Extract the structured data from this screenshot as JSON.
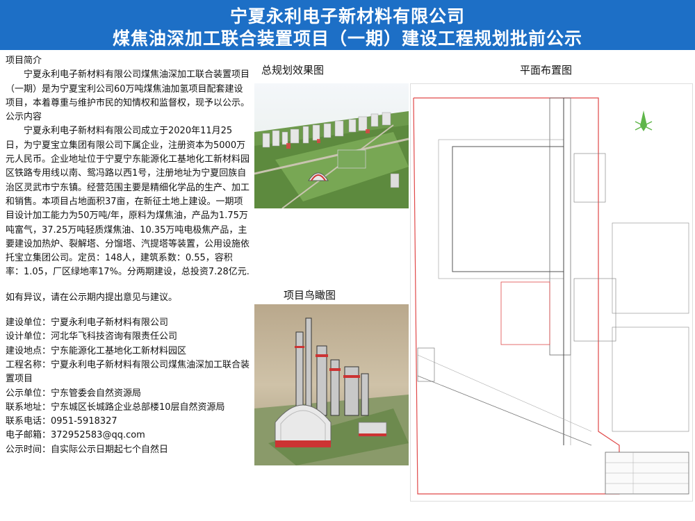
{
  "header": {
    "title_line1": "宁夏永利电子新材料有限公司",
    "title_line2": "煤焦油深加工联合装置项目（一期）建设工程规划批前公示"
  },
  "intro": {
    "heading": "项目简介",
    "text": "宁夏永利电子新材料有限公司煤焦油深加工联合装置项目（一期）是为宁夏宝利公司60万吨煤焦油加氢项目配套建设项目，本着尊重与维护市民的知情权和监督权，现予以公示。"
  },
  "content": {
    "heading": "公示内容",
    "text": "宁夏永利电子新材料有限公司成立于2020年11月25日，为宁夏宝立集团有限公司下属企业，注册资本为5000万元人民币。企业地址位于宁夏宁东能源化工基地化工新材料园区铁路专用线以南、鸳冯路以西1号，注册地址为宁夏回族自治区灵武市宁东镇。经营范围主要是精细化学品的生产、加工和销售。本项目占地面积37亩，在新征土地上建设。一期项目设计加工能力为50万吨/年，原料为煤焦油，产品为1.75万吨富气，37.25万吨轻质煤焦油、10.35万吨电极焦产品，主要建设加热炉、裂解塔、分馏塔、汽提塔等装置，公用设施依托宝立集团公司。定员：148人，建筑系数：0.55，容积率：1.05，厂区绿地率17%。分两期建设，总投资7.28亿元."
  },
  "objection": "如有异议，请在公示期内提出意见与建议。",
  "info": [
    "建设单位：宁夏永利电子新材料有限公司",
    "设计单位：河北华飞科技咨询有限责任公司",
    "建设地点：宁东能源化工基地化工新材料园区",
    "工程名称：宁夏永利电子新材料有限公司煤焦油深加工联合装置项目",
    "公示单位：宁东管委会自然资源局",
    "联系地址：宁东城区长城路企业总部楼10层自然资源局",
    "联系电话：0951-5918327",
    "电子邮箱：372952583@qq.com",
    "公示时间：自实际公示日期起七个自然日"
  ],
  "captions": {
    "master_plan": "总规划效果图",
    "aerial": "项目鸟瞰图",
    "layout": "平面布置图"
  },
  "colors": {
    "header_bg": "#1d6fc6",
    "plan_boundary": "#e04848"
  }
}
